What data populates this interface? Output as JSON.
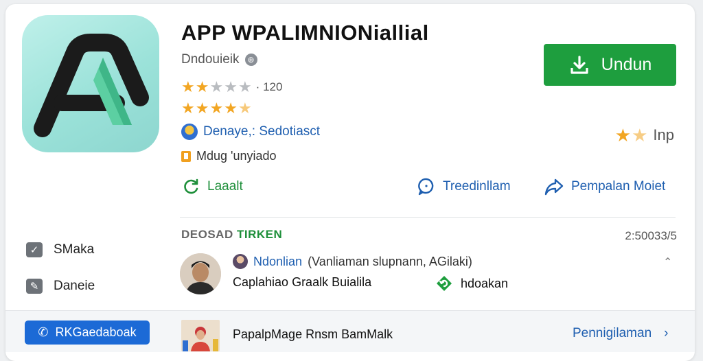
{
  "app": {
    "title": "APP WPALIMNIONiallial",
    "developer": "Dndouieik",
    "rating_count": "120",
    "publisher": "Denaye,: Sedotiasct",
    "category": "Mdug 'unyiado"
  },
  "install_button": {
    "label": "Undun",
    "icon": "download-icon"
  },
  "side_rating": {
    "label": "Inp",
    "stars_filled": 1.5
  },
  "ratings": {
    "row1_stars": 2,
    "row2_stars": 4.5
  },
  "actions": [
    {
      "label": "Laaalt",
      "icon": "refresh-icon"
    },
    {
      "label": "Treedinllam",
      "icon": "chat-bubble-icon"
    },
    {
      "label": "Pempalan Moiet",
      "icon": "share-icon"
    }
  ],
  "section": {
    "head": "DEOSAD",
    "head_accent": "TIRKEN",
    "date": "2:50033/5"
  },
  "sidebar": {
    "items": [
      {
        "label": "SMaka",
        "icon": "checkbox-icon"
      },
      {
        "label": "Daneie",
        "icon": "edit-icon"
      }
    ]
  },
  "review": {
    "name": "Ndonlian",
    "subtitle": "Vanliaman slupnann, AGilaki)",
    "text": "Caplahiao Graalk Buialila",
    "tag_label": "hdoakan",
    "tag_icon": "refresh-icon"
  },
  "bottom": {
    "call_button": "RKGaedaboak",
    "text": "PapalpMage Rnsm BamMalk",
    "link": "Pennigilaman"
  },
  "colors": {
    "install_green": "#1e9e3e",
    "link_blue": "#1f5fb0",
    "call_blue": "#1c6ad6",
    "star": "#f2a623"
  }
}
